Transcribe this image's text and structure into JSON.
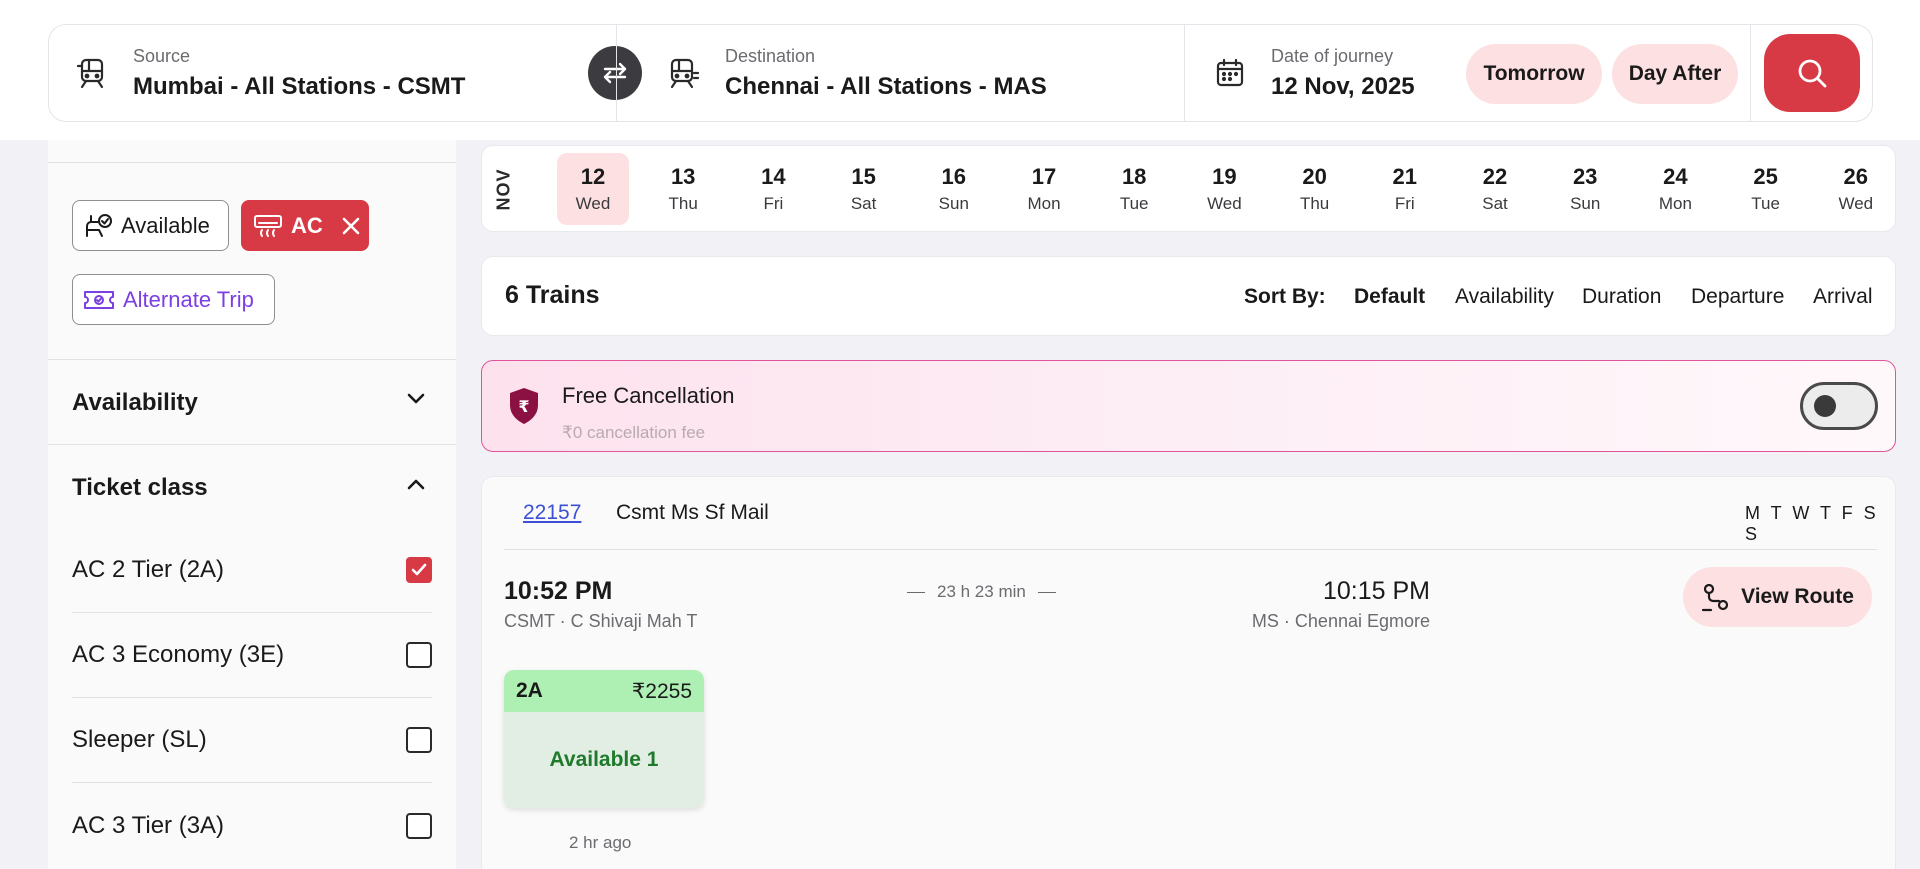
{
  "search": {
    "source_label": "Source",
    "source_value": "Mumbai - All Stations - CSMT",
    "destination_label": "Destination",
    "destination_value": "Chennai - All Stations - MAS",
    "date_label": "Date of journey",
    "date_value": "12 Nov, 2025",
    "quick_dates": [
      "Tomorrow",
      "Day After"
    ],
    "icons": [
      "train-icon",
      "swap-icon",
      "calendar-icon",
      "search-icon"
    ]
  },
  "filters": {
    "chips": [
      "Available",
      "AC",
      "Alternate Trip"
    ],
    "availability_title": "Availability",
    "ticket_class_title": "Ticket class",
    "ticket_classes": [
      {
        "label": "AC 2 Tier (2A)",
        "checked": true
      },
      {
        "label": "AC 3 Economy (3E)",
        "checked": false
      },
      {
        "label": "Sleeper (SL)",
        "checked": false
      },
      {
        "label": "AC 3 Tier (3A)",
        "checked": false
      }
    ]
  },
  "dates": {
    "month": "NOV",
    "days": [
      {
        "num": "12",
        "day": "Wed",
        "selected": true
      },
      {
        "num": "13",
        "day": "Thu"
      },
      {
        "num": "14",
        "day": "Fri"
      },
      {
        "num": "15",
        "day": "Sat"
      },
      {
        "num": "16",
        "day": "Sun"
      },
      {
        "num": "17",
        "day": "Mon"
      },
      {
        "num": "18",
        "day": "Tue"
      },
      {
        "num": "19",
        "day": "Wed"
      },
      {
        "num": "20",
        "day": "Thu"
      },
      {
        "num": "21",
        "day": "Fri"
      },
      {
        "num": "22",
        "day": "Sat"
      },
      {
        "num": "23",
        "day": "Sun"
      },
      {
        "num": "24",
        "day": "Mon"
      },
      {
        "num": "25",
        "day": "Tue"
      },
      {
        "num": "26",
        "day": "Wed"
      }
    ]
  },
  "results": {
    "count": "6 Trains",
    "sort_label": "Sort By:",
    "sort_options": [
      "Default",
      "Availability",
      "Duration",
      "Departure",
      "Arrival"
    ],
    "active_sort": "Default"
  },
  "free_cancellation": {
    "title": "Free Cancellation",
    "subtitle": "₹0 cancellation fee",
    "enabled": false
  },
  "train": {
    "number": "22157",
    "name": "Csmt Ms Sf Mail",
    "run_days": "M T W T F S S",
    "departure_time": "10:52 PM",
    "departure_station": "CSMT · C Shivaji Mah T",
    "duration": "23 h 23 min",
    "arrival_time": "10:15 PM",
    "arrival_station": "MS · Chennai Egmore",
    "view_route_label": "View Route",
    "class_code": "2A",
    "fare": "₹2255",
    "availability": "Available 1",
    "updated": "2 hr ago"
  },
  "colors": {
    "accent": "#d83a45",
    "accent_light": "#fde0e2",
    "available_green": "#1f7a2c",
    "alt_trip_purple": "#7b3fe4",
    "link_blue": "#3d4fd6"
  }
}
